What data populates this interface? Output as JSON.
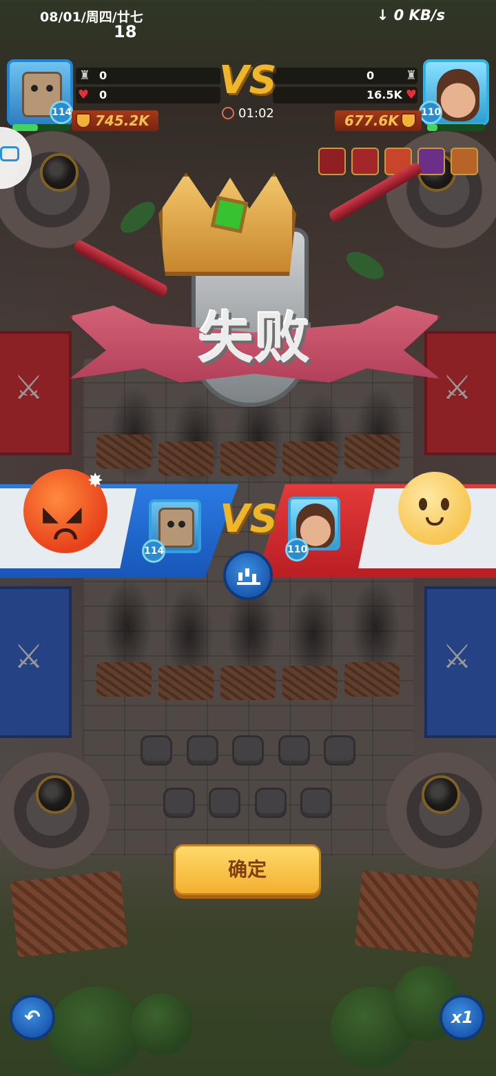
{
  "status_bar": {
    "date": "08/01/周四/廿七",
    "time": "18",
    "network_speed": "↓ 0 KB/s"
  },
  "hud": {
    "left_player": {
      "level": "114",
      "towers_destroyed": "0",
      "damage": "0",
      "power": "745.2K",
      "avatar": "robot-knight"
    },
    "right_player": {
      "level": "110",
      "towers_destroyed": "0",
      "damage": "16.5K",
      "power": "677.6K",
      "avatar": "hero-swordsman"
    },
    "vs_label": "VS",
    "timer": "01:02"
  },
  "result": {
    "title": "失败"
  },
  "versus_banner": {
    "vs_label": "VS",
    "left_level": "114",
    "right_level": "110",
    "left_emote": "angry-face",
    "right_emote": "smiling-face"
  },
  "confirm_label": "确定",
  "speed_label": "x1",
  "colors": {
    "blue_team": "#1f6fd6",
    "red_team": "#d92b2f",
    "gold": "#f0b62a",
    "confirm": "#f8c94a"
  }
}
